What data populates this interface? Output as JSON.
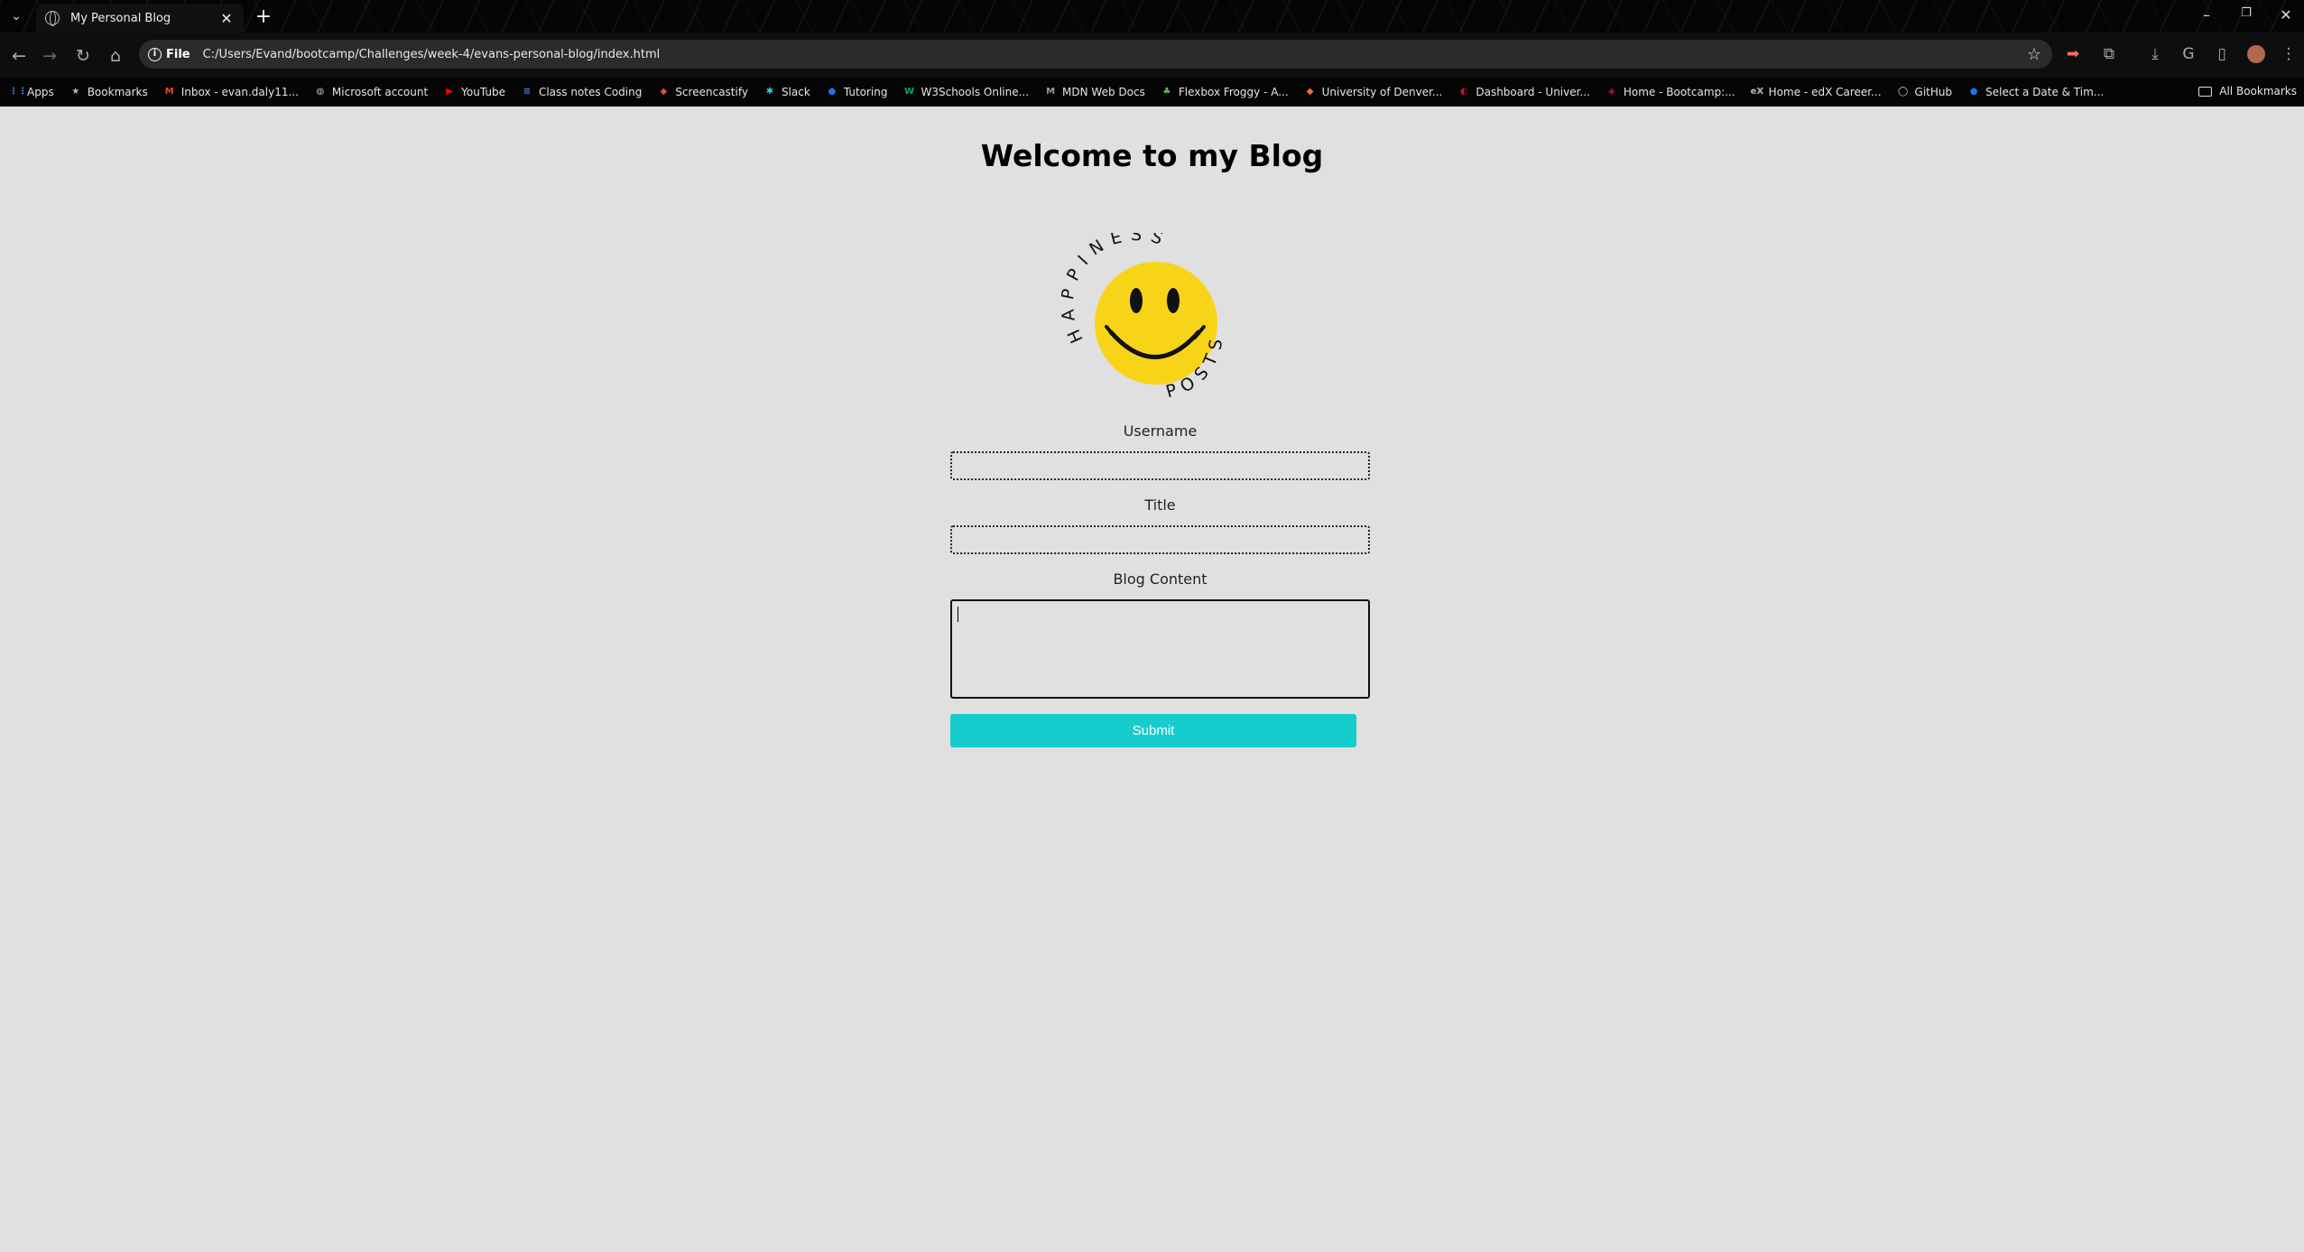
{
  "browser": {
    "tab": {
      "title": "My Personal Blog"
    },
    "address": {
      "chip": "File",
      "url": "C:/Users/Evand/bootcamp/Challenges/week-4/evans-personal-blog/index.html"
    },
    "bookmarks": [
      {
        "label": "Apps",
        "icon": "apps-grid-icon",
        "color": "#4a8af4"
      },
      {
        "label": "Bookmarks",
        "icon": "star-icon",
        "color": "#bbbbbb"
      },
      {
        "label": "Inbox - evan.daly11...",
        "icon": "gmail-icon",
        "color": "#ea4335"
      },
      {
        "label": "Microsoft account",
        "icon": "microsoft-icon",
        "color": "#bbbbbb"
      },
      {
        "label": "YouTube",
        "icon": "youtube-icon",
        "color": "#ff0000"
      },
      {
        "label": "Class notes Coding",
        "icon": "docs-icon",
        "color": "#4285f4"
      },
      {
        "label": "Screencastify",
        "icon": "screencastify-icon",
        "color": "#e84a3a"
      },
      {
        "label": "Slack",
        "icon": "slack-icon",
        "color": "#36c5f0"
      },
      {
        "label": "Tutoring",
        "icon": "tutoring-icon",
        "color": "#1a73e8"
      },
      {
        "label": "W3Schools Online...",
        "icon": "w3schools-icon",
        "color": "#04aa6d"
      },
      {
        "label": "MDN Web Docs",
        "icon": "mdn-icon",
        "color": "#999999"
      },
      {
        "label": "Flexbox Froggy - A...",
        "icon": "froggy-icon",
        "color": "#5cb85c"
      },
      {
        "label": "University of Denver...",
        "icon": "gitlab-icon",
        "color": "#fc6d26"
      },
      {
        "label": "Dashboard - Univer...",
        "icon": "canvas-icon",
        "color": "#c8102e"
      },
      {
        "label": "Home - Bootcamp:...",
        "icon": "shield-icon",
        "color": "#c8102e"
      },
      {
        "label": "Home - edX Career...",
        "icon": "edx-icon",
        "color": "#bbbbbb"
      },
      {
        "label": "GitHub",
        "icon": "github-icon",
        "color": "#dddddd"
      },
      {
        "label": "Select a Date & Tim...",
        "icon": "calendly-icon",
        "color": "#1a73e8"
      }
    ],
    "all_bookmarks": "All Bookmarks"
  },
  "page": {
    "heading": "Welcome to my Blog",
    "logo": {
      "arc_top": "HAPPINESS",
      "arc_bottom": "POSTS",
      "face_color": "#f7d417"
    },
    "form": {
      "username_label": "Username",
      "username_value": "",
      "title_label": "Title",
      "title_value": "",
      "content_label": "Blog Content",
      "content_value": "",
      "submit_label": "Submit"
    }
  },
  "colors": {
    "page_bg": "#e0e0e0",
    "submit_bg": "#17cccc",
    "chrome_bg": "#0e0e0e"
  }
}
